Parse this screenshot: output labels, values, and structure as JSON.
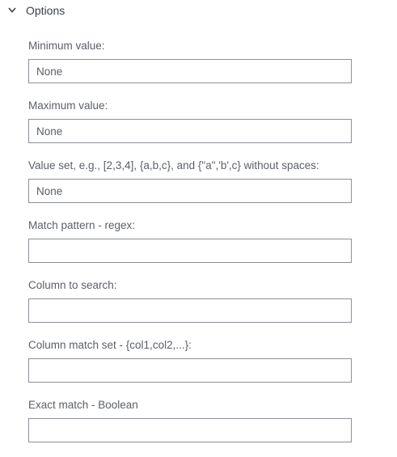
{
  "section": {
    "title": "Options",
    "icon": "chevron-down-icon",
    "expanded": true
  },
  "fields": [
    {
      "label": "Minimum value:",
      "value": "",
      "placeholder": "None"
    },
    {
      "label": "Maximum value:",
      "value": "",
      "placeholder": "None"
    },
    {
      "label": "Value set, e.g., [2,3,4], {a,b,c}, and {\"a\",'b',c} without spaces:",
      "value": "",
      "placeholder": "None"
    },
    {
      "label": "Match pattern - regex:",
      "value": "",
      "placeholder": ""
    },
    {
      "label": "Column to search:",
      "value": "",
      "placeholder": ""
    },
    {
      "label": "Column match set - {col1,col2,...}:",
      "value": "",
      "placeholder": ""
    },
    {
      "label": "Exact match - Boolean",
      "value": "",
      "placeholder": ""
    }
  ]
}
